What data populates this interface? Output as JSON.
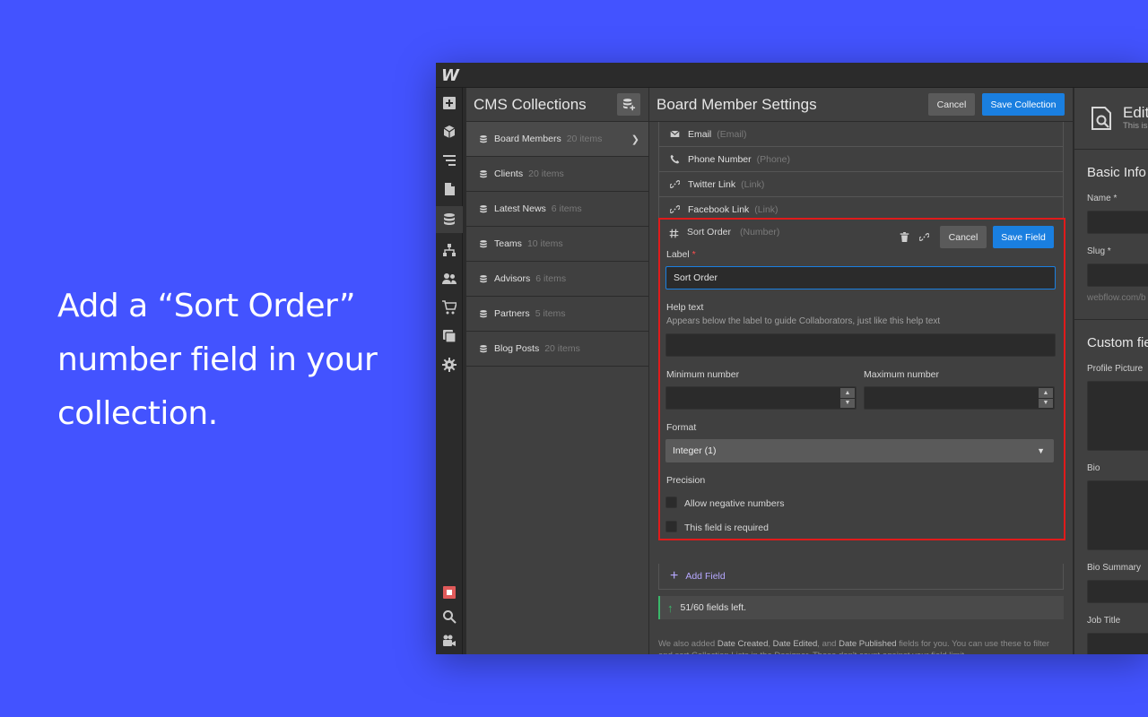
{
  "headline": {
    "line1": "Add a “Sort Order”",
    "line2": "number field in your",
    "line3": "collection."
  },
  "app": {
    "logo": "W",
    "collections": {
      "title": "CMS Collections",
      "items": [
        {
          "name": "Board Members",
          "count": "20 items"
        },
        {
          "name": "Clients",
          "count": "20 items"
        },
        {
          "name": "Latest News",
          "count": "6 items"
        },
        {
          "name": "Teams",
          "count": "10 items"
        },
        {
          "name": "Advisors",
          "count": "6 items"
        },
        {
          "name": "Partners",
          "count": "5 items"
        },
        {
          "name": "Blog Posts",
          "count": "20 items"
        }
      ]
    },
    "settings": {
      "title": "Board Member Settings",
      "cancel_label": "Cancel",
      "save_label": "Save Collection",
      "fields": [
        {
          "name": "Email",
          "type": "(Email)",
          "icon": "envelope-icon"
        },
        {
          "name": "Phone Number",
          "type": "(Phone)",
          "icon": "phone-icon"
        },
        {
          "name": "Twitter Link",
          "type": "(Link)",
          "icon": "link-icon"
        },
        {
          "name": "Facebook Link",
          "type": "(Link)",
          "icon": "link-icon"
        }
      ],
      "editor": {
        "field_name": "Sort Order",
        "field_type": "(Number)",
        "cancel_label": "Cancel",
        "save_label": "Save Field",
        "label_heading": "Label",
        "label_required_mark": "*",
        "label_value": "Sort Order",
        "help_heading": "Help text",
        "help_sub": "Appears below the label to guide Collaborators, just like this help text",
        "help_value": "",
        "min_heading": "Minimum number",
        "min_value": "",
        "max_heading": "Maximum number",
        "max_value": "",
        "format_heading": "Format",
        "format_value": "Integer (1)",
        "precision_heading": "Precision",
        "allow_negative_label": "Allow negative numbers",
        "allow_negative_checked": false,
        "required_label": "This field is required",
        "required_checked": false
      },
      "add_field_label": "Add Field",
      "fields_left": "51/60 fields left.",
      "note_pre": "We also added ",
      "note_b1": "Date Created",
      "note_mid1": ", ",
      "note_b2": "Date Edited",
      "note_mid2": ", and ",
      "note_b3": "Date Published",
      "note_post": " fields for you. You can use these to filter and sort Collection Lists in the Designer. These don't count against your field limit."
    },
    "edit_panel": {
      "title": "Edit",
      "subtitle": "This is",
      "basic_info": "Basic Info",
      "name_label": "Name *",
      "slug_label": "Slug *",
      "slug_hint": "webflow.com/b",
      "custom_fields": "Custom fie",
      "profile_picture": "Profile Picture",
      "bio": "Bio",
      "bio_summary": "Bio Summary",
      "job_title": "Job Title"
    }
  },
  "colors": {
    "background": "#4353ff",
    "accent_blue": "#1a7fe0",
    "highlight_red": "#e01b1b",
    "add_field_purple": "#b6a8ff",
    "success_green": "#3ab76a"
  }
}
